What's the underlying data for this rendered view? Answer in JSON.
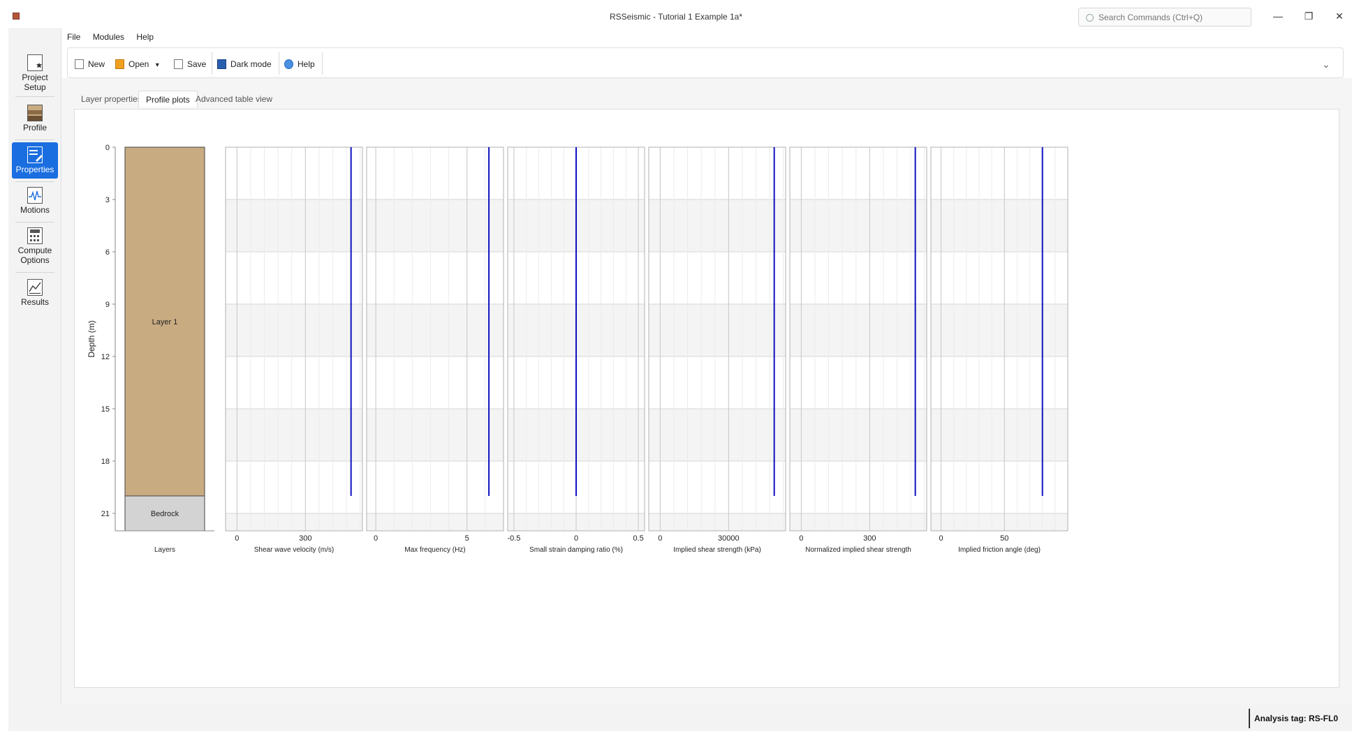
{
  "window": {
    "title": "RSSeismic - Tutorial 1 Example 1a*",
    "search_placeholder": "Search Commands (Ctrl+Q)",
    "minimize": "—",
    "restore": "❐",
    "close": "✕"
  },
  "menu": [
    "File",
    "Modules",
    "Help"
  ],
  "nav": [
    {
      "label": "Project Setup",
      "icon": "project-setup-icon"
    },
    {
      "label": "Profile",
      "icon": "profile-icon"
    },
    {
      "label": "Properties",
      "icon": "properties-icon",
      "active": true
    },
    {
      "label": "Motions",
      "icon": "motions-icon"
    },
    {
      "label": "Compute Options",
      "icon": "compute-options-icon"
    },
    {
      "label": "Results",
      "icon": "results-icon"
    }
  ],
  "toolbar": {
    "new": "New",
    "open": "Open",
    "save": "Save",
    "dark_mode": "Dark mode",
    "help": "Help",
    "collapse": "⌄"
  },
  "tabs": [
    "Layer properties",
    "Profile plots",
    "Advanced table view"
  ],
  "active_tab": 1,
  "chart_data": {
    "type": "line",
    "ylabel": "Depth (m)",
    "y_ticks": [
      "0",
      "3",
      "6",
      "9",
      "12",
      "15",
      "18",
      "21"
    ],
    "ylim": [
      0,
      22
    ],
    "y_inverted": true,
    "line_color": "#1010c0",
    "layers": [
      {
        "name": "Layer 1",
        "top": 0,
        "bottom": 20,
        "color": "#c9ab82"
      },
      {
        "name": "Bedrock",
        "top": 20,
        "bottom": 22,
        "color": "#d3d3d3"
      }
    ],
    "layers_label": "Layers",
    "panels": [
      {
        "xlabel": "Shear wave velocity (m/s)",
        "ticks": [
          0,
          300
        ],
        "tick_labels": [
          "0",
          "300"
        ],
        "xlim": [
          -50,
          550
        ],
        "value": 500,
        "depth": [
          0,
          20
        ]
      },
      {
        "xlabel": "Max frequency (Hz)",
        "ticks": [
          0,
          5
        ],
        "tick_labels": [
          "0",
          "5"
        ],
        "xlim": [
          -0.5,
          7
        ],
        "value": 6.2,
        "depth": [
          0,
          20
        ]
      },
      {
        "xlabel": "Small strain damping ratio (%)",
        "ticks": [
          -0.5,
          0,
          0.5
        ],
        "tick_labels": [
          "-0.5",
          "0",
          "0.5"
        ],
        "xlim": [
          -0.55,
          0.55
        ],
        "value": 0,
        "depth": [
          0,
          20
        ]
      },
      {
        "xlabel": "Implied shear strength (kPa)",
        "ticks": [
          0,
          30000
        ],
        "tick_labels": [
          "0",
          "30000"
        ],
        "xlim": [
          -5000,
          55000
        ],
        "value": 50000,
        "depth": [
          0,
          20
        ]
      },
      {
        "xlabel": "Normalized implied shear strength",
        "ticks": [
          0,
          300
        ],
        "tick_labels": [
          "0",
          "300"
        ],
        "xlim": [
          -50,
          550
        ],
        "value": 500,
        "depth": [
          0,
          20
        ]
      },
      {
        "xlabel": "Implied friction angle (deg)",
        "ticks": [
          0,
          50
        ],
        "tick_labels": [
          "0",
          "50"
        ],
        "xlim": [
          -8,
          100
        ],
        "value": 80,
        "depth": [
          0,
          20
        ]
      }
    ]
  },
  "status": {
    "analysis_tag": "Analysis tag: RS-FL0"
  }
}
